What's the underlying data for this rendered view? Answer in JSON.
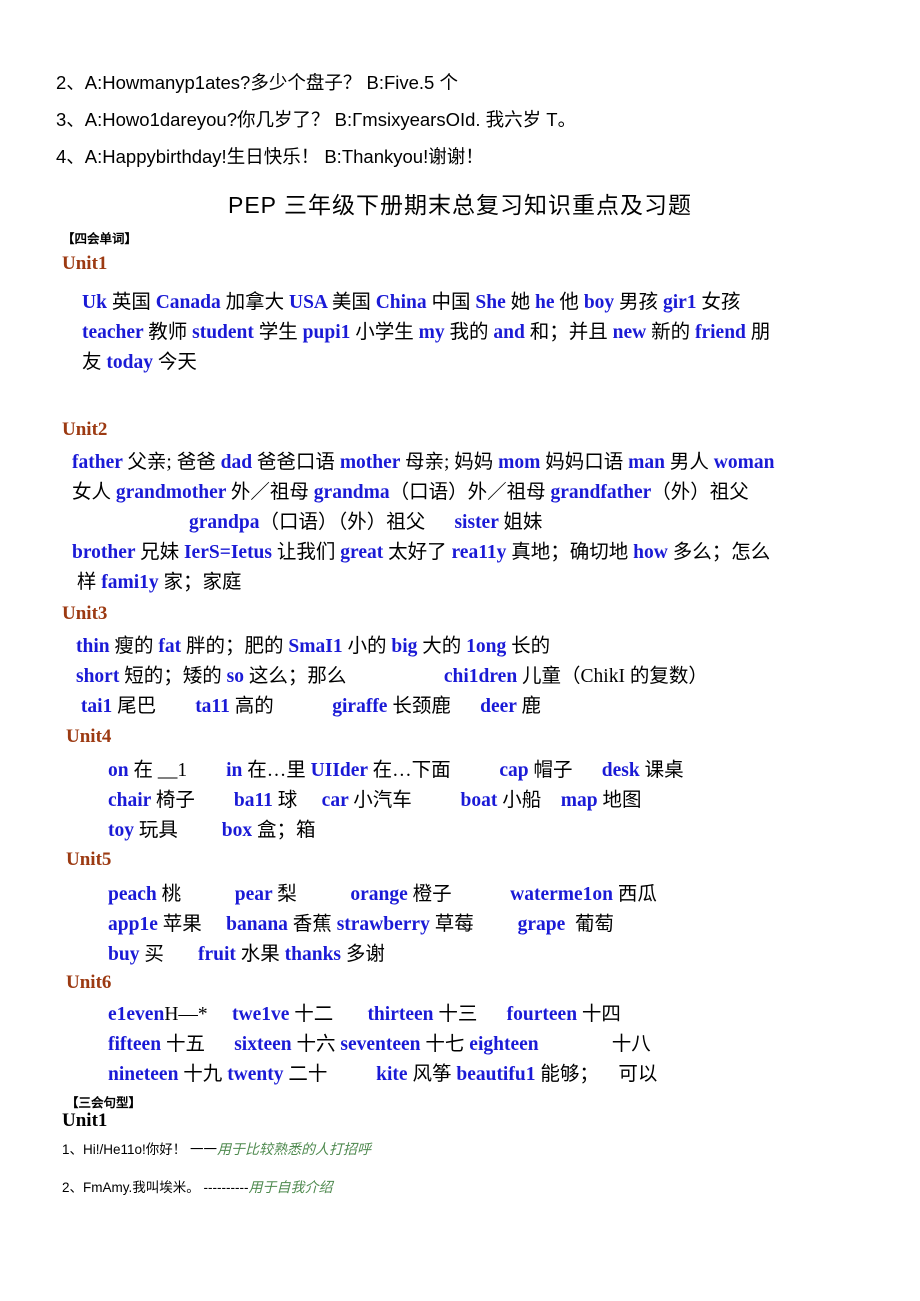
{
  "document": {
    "title": "PEP 三年级下册期末总复习知识重点及习题",
    "top_lines": [
      "2、A:Howmanyp1ates?多少个盘子？ B:Five.5 个",
      "3、A:Howo1dareyou?你几岁了？ B:ΓmsixyearsOId. 我六岁 T。",
      "4、A:Happybirthday!生日快乐！ B:Thankyou!谢谢！"
    ],
    "section_tags": {
      "four_skills": "【四会单词】",
      "three_skills": "【三会句型】"
    },
    "units": [
      {
        "heading": "Unit1",
        "lines": [
          [
            {
              "t": "en",
              "v": "Uk "
            },
            {
              "t": "cn",
              "v": "英国 "
            },
            {
              "t": "en",
              "v": "Canada "
            },
            {
              "t": "cn",
              "v": "加拿大 "
            },
            {
              "t": "en",
              "v": "USA "
            },
            {
              "t": "cn",
              "v": "美国 "
            },
            {
              "t": "en",
              "v": "China "
            },
            {
              "t": "cn",
              "v": "中国 "
            },
            {
              "t": "en",
              "v": "She "
            },
            {
              "t": "cn",
              "v": "她 "
            },
            {
              "t": "en",
              "v": "he "
            },
            {
              "t": "cn",
              "v": "他 "
            },
            {
              "t": "en",
              "v": "boy "
            },
            {
              "t": "cn",
              "v": "男孩 "
            },
            {
              "t": "en",
              "v": "gir1 "
            },
            {
              "t": "cn",
              "v": "女孩"
            }
          ],
          [
            {
              "t": "en",
              "v": "teacher "
            },
            {
              "t": "cn",
              "v": "教师 "
            },
            {
              "t": "en",
              "v": "student "
            },
            {
              "t": "cn",
              "v": "学生 "
            },
            {
              "t": "en",
              "v": "pupi1 "
            },
            {
              "t": "cn",
              "v": "小学生 "
            },
            {
              "t": "en",
              "v": "my "
            },
            {
              "t": "cn",
              "v": "我的 "
            },
            {
              "t": "en",
              "v": "and "
            },
            {
              "t": "cn",
              "v": "和；并且 "
            },
            {
              "t": "en",
              "v": "new "
            },
            {
              "t": "cn",
              "v": "新的 "
            },
            {
              "t": "en",
              "v": "friend "
            },
            {
              "t": "cn",
              "v": "朋"
            }
          ],
          [
            {
              "t": "cn",
              "v": "友 "
            },
            {
              "t": "en",
              "v": "today "
            },
            {
              "t": "cn",
              "v": "今天"
            }
          ]
        ]
      },
      {
        "heading": "Unit2",
        "lines": [
          [
            {
              "t": "en",
              "v": "father "
            },
            {
              "t": "cn",
              "v": "父亲; 爸爸 "
            },
            {
              "t": "en",
              "v": "dad "
            },
            {
              "t": "cn",
              "v": "爸爸口语 "
            },
            {
              "t": "en",
              "v": "mother "
            },
            {
              "t": "cn",
              "v": "母亲; 妈妈 "
            },
            {
              "t": "en",
              "v": "mom "
            },
            {
              "t": "cn",
              "v": "妈妈口语 "
            },
            {
              "t": "en",
              "v": "man "
            },
            {
              "t": "cn",
              "v": "男人 "
            },
            {
              "t": "en",
              "v": "woman"
            }
          ],
          [
            {
              "t": "cn",
              "v": "女人 "
            },
            {
              "t": "en",
              "v": "grandmother "
            },
            {
              "t": "cn",
              "v": "外／祖母 "
            },
            {
              "t": "en",
              "v": "grandma"
            },
            {
              "t": "cn",
              "v": "（口语）外／祖母 "
            },
            {
              "t": "en",
              "v": "grandfather"
            },
            {
              "t": "cn",
              "v": "（外）祖父"
            }
          ],
          [
            {
              "t": "cn",
              "v": "                        "
            },
            {
              "t": "en",
              "v": "grandpa"
            },
            {
              "t": "cn",
              "v": "（口语）（外）祖父      "
            },
            {
              "t": "en",
              "v": "sister "
            },
            {
              "t": "cn",
              "v": "姐妹"
            }
          ],
          [
            {
              "t": "en",
              "v": "brother "
            },
            {
              "t": "cn",
              "v": "兄妹 "
            },
            {
              "t": "en",
              "v": "IerS=Ietus "
            },
            {
              "t": "cn",
              "v": "让我们 "
            },
            {
              "t": "en",
              "v": "great "
            },
            {
              "t": "cn",
              "v": "太好了 "
            },
            {
              "t": "en",
              "v": "rea11y "
            },
            {
              "t": "cn",
              "v": "真地；确切地 "
            },
            {
              "t": "en",
              "v": "how "
            },
            {
              "t": "cn",
              "v": "多么；怎么"
            }
          ],
          [
            {
              "t": "cn",
              "v": " 样 "
            },
            {
              "t": "en",
              "v": "fami1y "
            },
            {
              "t": "cn",
              "v": "家；家庭"
            }
          ]
        ]
      },
      {
        "heading": "Unit3",
        "lines": [
          [
            {
              "t": "en",
              "v": "thin "
            },
            {
              "t": "cn",
              "v": "瘦的 "
            },
            {
              "t": "en",
              "v": "fat "
            },
            {
              "t": "cn",
              "v": "胖的；肥的 "
            },
            {
              "t": "en",
              "v": "SmaI1 "
            },
            {
              "t": "cn",
              "v": "小的 "
            },
            {
              "t": "en",
              "v": "big "
            },
            {
              "t": "cn",
              "v": "大的 "
            },
            {
              "t": "en",
              "v": "1ong "
            },
            {
              "t": "cn",
              "v": "长的"
            }
          ],
          [
            {
              "t": "en",
              "v": "short "
            },
            {
              "t": "cn",
              "v": "短的；矮的 "
            },
            {
              "t": "en",
              "v": "so "
            },
            {
              "t": "cn",
              "v": "这么；那么                    "
            },
            {
              "t": "en",
              "v": "chi1dren "
            },
            {
              "t": "cn",
              "v": "儿童（ChikI 的复数）"
            }
          ],
          [
            {
              "t": "en",
              "v": " tai1 "
            },
            {
              "t": "cn",
              "v": "尾巴        "
            },
            {
              "t": "en",
              "v": "ta11 "
            },
            {
              "t": "cn",
              "v": "高的            "
            },
            {
              "t": "en",
              "v": "giraffe "
            },
            {
              "t": "cn",
              "v": "长颈鹿      "
            },
            {
              "t": "en",
              "v": "deer "
            },
            {
              "t": "cn",
              "v": "鹿"
            }
          ]
        ]
      },
      {
        "heading": "Unit4",
        "lines": [
          [
            {
              "t": "en",
              "v": "on "
            },
            {
              "t": "cn",
              "v": "在 __1        "
            },
            {
              "t": "en",
              "v": "in "
            },
            {
              "t": "cn",
              "v": "在…里 "
            },
            {
              "t": "en",
              "v": "UIIder "
            },
            {
              "t": "cn",
              "v": "在…下面          "
            },
            {
              "t": "en",
              "v": "cap "
            },
            {
              "t": "cn",
              "v": "帽子      "
            },
            {
              "t": "en",
              "v": "desk "
            },
            {
              "t": "cn",
              "v": "课桌"
            }
          ],
          [
            {
              "t": "en",
              "v": "chair "
            },
            {
              "t": "cn",
              "v": "椅子        "
            },
            {
              "t": "en",
              "v": "ba11 "
            },
            {
              "t": "cn",
              "v": "球     "
            },
            {
              "t": "en",
              "v": "car "
            },
            {
              "t": "cn",
              "v": "小汽车          "
            },
            {
              "t": "en",
              "v": "boat "
            },
            {
              "t": "cn",
              "v": "小船    "
            },
            {
              "t": "en",
              "v": "map "
            },
            {
              "t": "cn",
              "v": "地图"
            }
          ],
          [
            {
              "t": "en",
              "v": "toy "
            },
            {
              "t": "cn",
              "v": "玩具         "
            },
            {
              "t": "en",
              "v": "box "
            },
            {
              "t": "cn",
              "v": "盒；箱"
            }
          ]
        ]
      },
      {
        "heading": "Unit5",
        "lines": [
          [
            {
              "t": "en",
              "v": "peach "
            },
            {
              "t": "cn",
              "v": "桃           "
            },
            {
              "t": "en",
              "v": "pear "
            },
            {
              "t": "cn",
              "v": "梨           "
            },
            {
              "t": "en",
              "v": "orange "
            },
            {
              "t": "cn",
              "v": "橙子            "
            },
            {
              "t": "en",
              "v": "waterme1on "
            },
            {
              "t": "cn",
              "v": "西瓜"
            }
          ],
          [
            {
              "t": "en",
              "v": "app1e "
            },
            {
              "t": "cn",
              "v": "苹果     "
            },
            {
              "t": "en",
              "v": "banana "
            },
            {
              "t": "cn",
              "v": "香蕉 "
            },
            {
              "t": "en",
              "v": "strawberry "
            },
            {
              "t": "cn",
              "v": "草莓         "
            },
            {
              "t": "en",
              "v": "grape "
            },
            {
              "t": "cn",
              "v": " 葡萄"
            }
          ],
          [
            {
              "t": "en",
              "v": "buy "
            },
            {
              "t": "cn",
              "v": "买       "
            },
            {
              "t": "en",
              "v": "fruit "
            },
            {
              "t": "cn",
              "v": "水果 "
            },
            {
              "t": "en",
              "v": "thanks "
            },
            {
              "t": "cn",
              "v": "多谢"
            }
          ]
        ]
      },
      {
        "heading": "Unit6",
        "lines": [
          [
            {
              "t": "en",
              "v": "e1even"
            },
            {
              "t": "cn",
              "v": "H—*     "
            },
            {
              "t": "en",
              "v": "twe1ve "
            },
            {
              "t": "cn",
              "v": "十二       "
            },
            {
              "t": "en",
              "v": "thirteen "
            },
            {
              "t": "cn",
              "v": "十三      "
            },
            {
              "t": "en",
              "v": "fourteen "
            },
            {
              "t": "cn",
              "v": "十四"
            }
          ],
          [
            {
              "t": "en",
              "v": "fifteen "
            },
            {
              "t": "cn",
              "v": "十五      "
            },
            {
              "t": "en",
              "v": "sixteen "
            },
            {
              "t": "cn",
              "v": "十六 "
            },
            {
              "t": "en",
              "v": "seventeen "
            },
            {
              "t": "cn",
              "v": "十七 "
            },
            {
              "t": "en",
              "v": "eighteen "
            },
            {
              "t": "cn",
              "v": "              十八"
            }
          ],
          [
            {
              "t": "en",
              "v": "nineteen "
            },
            {
              "t": "cn",
              "v": "十九 "
            },
            {
              "t": "en",
              "v": "twenty "
            },
            {
              "t": "cn",
              "v": "二十          "
            },
            {
              "t": "en",
              "v": "kite "
            },
            {
              "t": "cn",
              "v": "风筝 "
            },
            {
              "t": "en",
              "v": "beautifu1 "
            },
            {
              "t": "cn",
              "v": "能够；    可以"
            }
          ]
        ]
      }
    ],
    "sentence_patterns": {
      "heading": "Unit1",
      "items": [
        {
          "text": "1、Hi!/He11o!你好！ 一一",
          "note": "用于比较熟悉的人打招呼"
        },
        {
          "text": "2、FmAmy.我叫埃米。 ----------",
          "note": "用于自我介绍"
        }
      ]
    }
  }
}
